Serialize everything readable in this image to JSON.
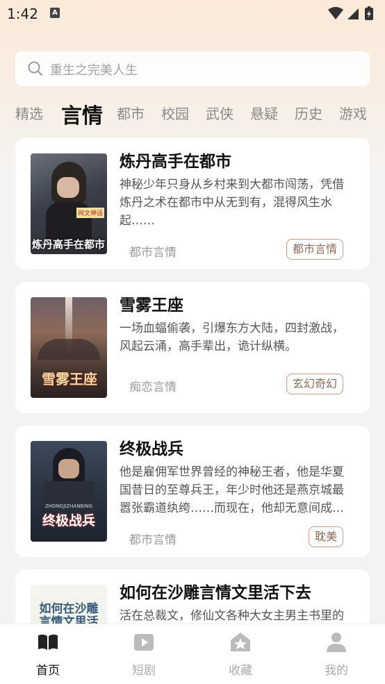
{
  "status_bar": {
    "time": "1:42"
  },
  "search": {
    "placeholder": "重生之完美人生"
  },
  "tabs": [
    {
      "label": "精选"
    },
    {
      "label": "言情",
      "active": true
    },
    {
      "label": "都市"
    },
    {
      "label": "校园"
    },
    {
      "label": "武侠"
    },
    {
      "label": "悬疑"
    },
    {
      "label": "历史"
    },
    {
      "label": "游戏"
    }
  ],
  "books": [
    {
      "title": "炼丹高手在都市",
      "description": "神秘少年只身从乡村来到大都市闯荡，凭借炼丹之术在都市中从无到有，混得风生水起……",
      "category": "都市言情",
      "tag": "都市言情",
      "cover_text": "炼丹高手在都市",
      "cover_badge": "网文神话"
    },
    {
      "title": "雪雾王座",
      "description": "一场血蝠偷袭，引爆东方大陆，四封激战，风起云涌，高手辈出，诡计纵横。",
      "category": "痴恋言情",
      "tag": "玄幻奇幻",
      "cover_text": "雪雾王座"
    },
    {
      "title": "终极战兵",
      "description": "他是雇佣军世界曾经的神秘王者，他是华夏国昔日的至尊兵王，年少时他还是燕京城最嚣张霸道纨绔……而现在，他却无意间成了…",
      "category": "都市言情",
      "tag": "耽美",
      "cover_text": "终极战兵",
      "cover_sub": "ZHONGJIZHANBING"
    },
    {
      "title": "如何在沙雕言情文里活下去",
      "description": "活在总裁文，修仙文各种大女主男主书里的",
      "cover_text": "如何在沙雕言情文里活下去"
    }
  ],
  "bottom_nav": [
    {
      "label": "首页",
      "icon": "book-icon",
      "active": true
    },
    {
      "label": "短剧",
      "icon": "play-icon"
    },
    {
      "label": "收藏",
      "icon": "star-house-icon"
    },
    {
      "label": "我的",
      "icon": "person-icon"
    }
  ],
  "colors": {
    "accent_tag_border": "#c79d83",
    "active_text": "#111111",
    "inactive_text": "#8a8a8a"
  }
}
